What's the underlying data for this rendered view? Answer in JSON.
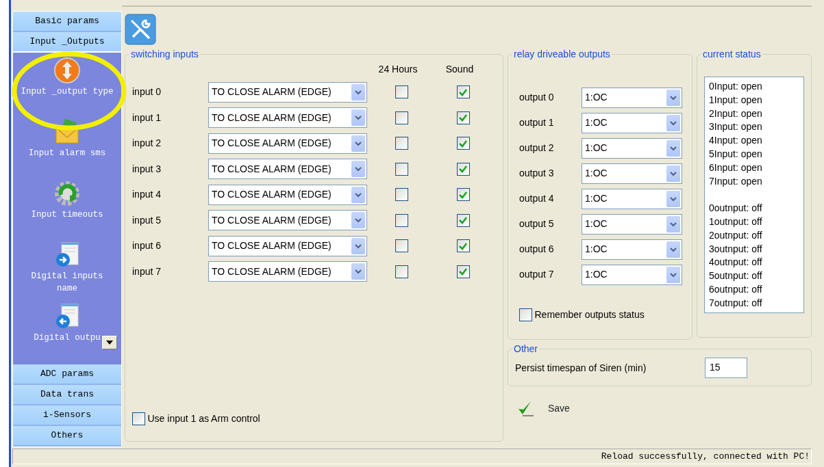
{
  "sidebar": {
    "sections": [
      {
        "label": "Basic params",
        "expanded": false
      },
      {
        "label": "Input _Outputs",
        "expanded": true,
        "items": [
          {
            "label": "Input _output type"
          },
          {
            "label": "Input alarm sms"
          },
          {
            "label": "Input timeouts"
          },
          {
            "label": "Digital inputs name"
          },
          {
            "label": "Digital outpu"
          }
        ]
      },
      {
        "label": "ADC params",
        "expanded": false
      },
      {
        "label": "Data trans",
        "expanded": false
      },
      {
        "label": "i-Sensors",
        "expanded": false
      },
      {
        "label": "Others",
        "expanded": false
      }
    ]
  },
  "switching_inputs": {
    "title": "switching inputs",
    "column_headers": [
      "24 Hours",
      "Sound"
    ],
    "rows": [
      {
        "label": "input 0",
        "mode": "TO CLOSE ALARM (EDGE)",
        "hours_24": false,
        "sound": true
      },
      {
        "label": "input 1",
        "mode": "TO CLOSE ALARM (EDGE)",
        "hours_24": false,
        "sound": true
      },
      {
        "label": "input 2",
        "mode": "TO CLOSE ALARM (EDGE)",
        "hours_24": false,
        "sound": true
      },
      {
        "label": "input 3",
        "mode": "TO CLOSE ALARM (EDGE)",
        "hours_24": false,
        "sound": true
      },
      {
        "label": "input 4",
        "mode": "TO CLOSE ALARM (EDGE)",
        "hours_24": false,
        "sound": true
      },
      {
        "label": "input 5",
        "mode": "TO CLOSE ALARM (EDGE)",
        "hours_24": false,
        "sound": true
      },
      {
        "label": "input 6",
        "mode": "TO CLOSE ALARM (EDGE)",
        "hours_24": false,
        "sound": true
      },
      {
        "label": "input 7",
        "mode": "TO CLOSE ALARM (EDGE)",
        "hours_24": false,
        "sound": true
      }
    ],
    "arm_control": {
      "label": "Use input 1 as Arm control",
      "checked": false
    }
  },
  "relay_outputs": {
    "title": "relay driveable outputs",
    "rows": [
      {
        "label": "output 0",
        "mode": "1:OC"
      },
      {
        "label": "output 1",
        "mode": "1:OC"
      },
      {
        "label": "output 2",
        "mode": "1:OC"
      },
      {
        "label": "output 3",
        "mode": "1:OC"
      },
      {
        "label": "output 4",
        "mode": "1:OC"
      },
      {
        "label": "output 5",
        "mode": "1:OC"
      },
      {
        "label": "output 6",
        "mode": "1:OC"
      },
      {
        "label": "output 7",
        "mode": "1:OC"
      }
    ],
    "remember": {
      "label": "Remember outputs status",
      "checked": false
    }
  },
  "current_status": {
    "title": "current status",
    "inputs": [
      "0Input: open",
      "1Input: open",
      "2Input: open",
      "3Input: open",
      "4Input: open",
      "5Input: open",
      "6Input: open",
      "7Input: open"
    ],
    "outputs": [
      "0outnput: off",
      "1outnput: off",
      "2outnput: off",
      "3outnput: off",
      "4outnput: off",
      "5outnput: off",
      "6outnput: off",
      "7outnput: off"
    ]
  },
  "other": {
    "title": "Other",
    "siren_label": "Persist timespan of Siren (min)",
    "siren_value": "15"
  },
  "save_button": "Save",
  "status_bar": "Reload successfully, connected with PC!"
}
